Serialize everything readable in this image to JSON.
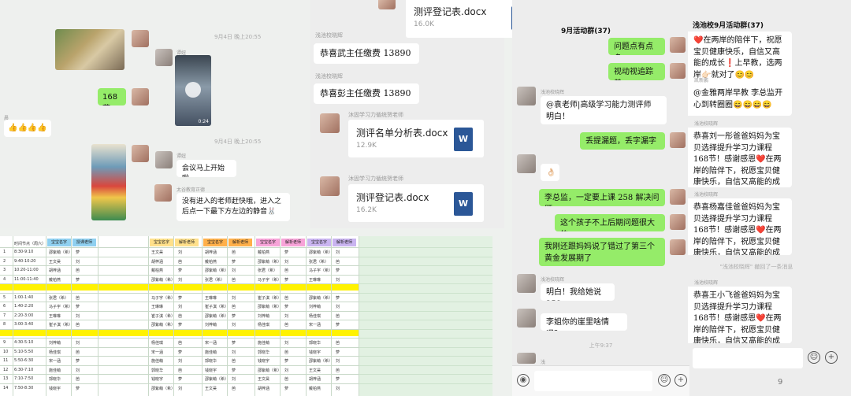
{
  "left_chat": {
    "time1": "9月4日 晚上20:55",
    "time2": "9月4日 晚上20:55",
    "bubble_168": "168 节",
    "thumbs": "👍👍👍👍",
    "sender_a": "晨",
    "sender_b": "谭妞",
    "sender_c": "谭妞",
    "sender_d": "太谷教育正德",
    "video_duration": "0:24",
    "msg_meeting": "会议马上开始啦",
    "msg_enter": "没有进入的老师赶快哦，进入之后点一下最下方左边的静音🐰"
  },
  "mid_chat": {
    "sender": "浅池校晓辉",
    "msg1": "恭喜武主任缴费 13890",
    "msg2": "恭喜彭主任缴费 13890",
    "file_top_name": "测评登记表.docx",
    "file_top_size": "16.0K",
    "sender_file1": "沐固学习力循统贺老师",
    "file1_name": "测评名单分析表.docx",
    "file1_size": "12.9K",
    "sender_file2": "沐固学习力循统贺老师",
    "file2_name": "测评登记表.docx",
    "file2_size": "16.2K",
    "word_icon": "W"
  },
  "right_chat1": {
    "title": "9月活动群(37)",
    "b1": "问题点有点多",
    "b2": "视动视追踪差",
    "sender1": "浅池校晓辉",
    "b3": "@袁老师|高级学习能力测评师 明白！",
    "b4": "丢提漏题，丢字漏字",
    "b5": "👌🏻",
    "b6": "李总监，一定要上课 258 解决问题",
    "b7": "这个孩子不上后期问题很大的",
    "b8": "我刚还跟妈妈说了错过了第三个黄金发展期了",
    "sender2": "浅池校晓辉",
    "b9": "明白！我给她说 258",
    "b10": "李姐你的崖里啥情况？",
    "time": "上午9:37",
    "sender3": "浅"
  },
  "right_chat2": {
    "title": "浅池校9月活动群(37)",
    "m1": "❤️在两岸的陪伴下，祝愿宝贝健康快乐，自信又高能的成长❗上早教，选两岸👉🏻就对了😊😊",
    "sender1": "凯新鹏",
    "m2": "@金雅两岸早教 李总监开心到转圈圈😄😄😄😄",
    "sender2": "浅池校晓辉",
    "m3": "恭喜刘一彤爸爸妈妈为宝贝选择提升学习力课程168节！感谢感恩❤️在两岸的陪伴下，祝愿宝贝健康快乐，自信又高能的成长❗上早教，选两岸👉🏻就对了😊😊",
    "sender3": "浅池校晓辉",
    "m4": "恭喜杨嘉佳爸爸妈妈为宝贝选择提升学习力课程168节！感谢感恩❤️在两岸的陪伴下，祝愿宝贝健康快乐，自信又高能的成长❗上早教，选两岸👉🏻就对了😊😊",
    "sys": "\"浅池校晓辉\" 撤回了一条消息",
    "sender4": "浅池校晓辉",
    "m5": "恭喜王小飞爸爸妈妈为宝贝选择提升学习力课程168节！感谢感恩❤️在两岸的陪伴下，祝愿宝贝健康快乐，自信又高能的成长❗上早教，选两岸👉🏻就对了😊😊",
    "page_num": "9"
  },
  "sheet": {
    "header_cols": [
      "宝宝名字",
      "授课老师",
      "宝宝名字",
      "解析老师",
      "宝宝名字",
      "解析老师",
      "宝宝名字",
      "解析老师",
      "宝宝名字",
      "解析老师"
    ],
    "time_col_header": "时间节点（周六）",
    "times": [
      "8:30-9:10",
      "9:40-10:20",
      "10:20-11:00",
      "11:00-11:40",
      "",
      "1:00-1:40",
      "1:40-2:20",
      "2:20-3:00",
      "3:00-3:40",
      "",
      "4:30-5:10",
      "5:10-5:50",
      "5:50-6:30",
      "6:30-7:10",
      "7:10-7:50",
      "7:50-8:30"
    ],
    "row_nums": [
      "1",
      "2",
      "3",
      "4",
      "",
      "5",
      "6",
      "7",
      "8",
      "",
      "9",
      "10",
      "11",
      "12",
      "13",
      "14"
    ],
    "sample_names": [
      "邵紫萌（希）",
      "王文昊",
      "胡梓涵",
      "戴柏燕",
      "",
      "张君（希）",
      "马子宇（希）",
      "王琳琳",
      "崔子淇（希）",
      "",
      "刘梓萌",
      "杨佳琪",
      "宋一涵",
      "施佳萌",
      "郭晓华",
      "钱晓宇"
    ],
    "teacher_a": "萝",
    "teacher_b": "刘",
    "teacher_c": "芭"
  }
}
